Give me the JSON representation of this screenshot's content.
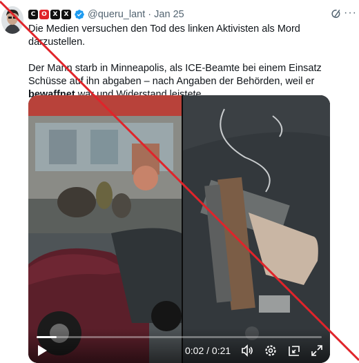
{
  "author": {
    "badges": [
      "C",
      "O",
      "X",
      "X"
    ],
    "handle": "@queru_lant",
    "separator": "·",
    "date": "Jan 25",
    "avatar_icon": "avatar-portrait",
    "verified_icon": "verified-badge-icon"
  },
  "tweet": {
    "line1": "Die Medien versuchen den Tod des linken Aktivisten als Mord darzustellen.",
    "para2_before": "Der Mann starb in Minneapolis, als ICE-Beamte bei einem Einsatz Schüsse auf ihn abgaben – nach Angaben der Behörden, weil er ",
    "para2_bold": "bewaffnet",
    "para2_after": " war und Widerstand leistete."
  },
  "video": {
    "left_scene": "street-arrest-scene",
    "right_scene": "pistol-on-car-seat",
    "time_current": "0:02",
    "time_separator": " / ",
    "time_total": "0:21",
    "progress": 0.07,
    "icons": [
      "play-icon",
      "volume-icon",
      "settings-icon",
      "pip-icon",
      "fullscreen-icon"
    ]
  },
  "overlay": {
    "color": "#e0242a",
    "type": "diagonal-strike"
  },
  "colors": {
    "text": "#0f1419",
    "secondary": "#536471",
    "verified": "#1d9bf0"
  }
}
